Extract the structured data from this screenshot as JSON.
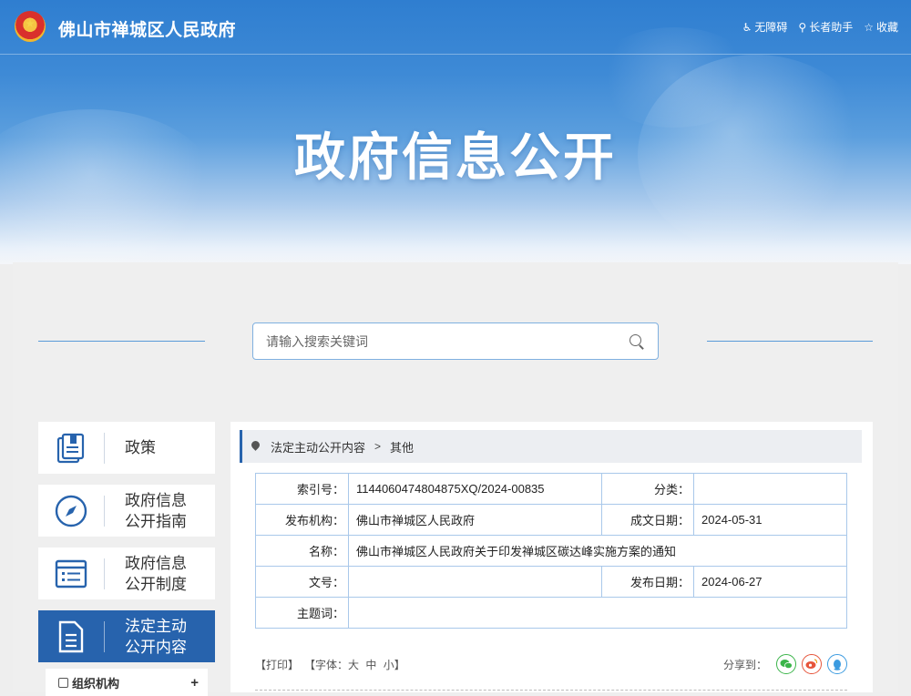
{
  "header": {
    "site_title": "佛山市禅城区人民政府",
    "toolbar": [
      {
        "icon": "accessibility-icon",
        "label": "无障碍"
      },
      {
        "icon": "elder-assistant-icon",
        "label": "长者助手"
      },
      {
        "icon": "star-icon",
        "label": "收藏"
      }
    ],
    "hero_title": "政府信息公开"
  },
  "search": {
    "placeholder": "请输入搜索关键词",
    "value": ""
  },
  "sidebar": {
    "items": [
      {
        "label": "政策",
        "icon": "document-icon",
        "active": false
      },
      {
        "label": "政府信息\n公开指南",
        "icon": "compass-icon",
        "active": false
      },
      {
        "label": "政府信息\n公开制度",
        "icon": "list-icon",
        "active": false
      },
      {
        "label": "法定主动\n公开内容",
        "icon": "file-icon",
        "active": true
      }
    ],
    "sub_item": {
      "label": "组织机构",
      "icon": "folder-icon",
      "expander": "+"
    }
  },
  "breadcrumb": {
    "items": [
      "法定主动公开内容",
      "其他"
    ],
    "separator": ">"
  },
  "meta": {
    "index_label": "索引号：",
    "index_value": "1144060474804875XQ/2024-00835",
    "category_label": "分类：",
    "category_value": "",
    "publisher_label": "发布机构：",
    "publisher_value": "佛山市禅城区人民政府",
    "written_date_label": "成文日期：",
    "written_date_value": "2024-05-31",
    "name_label": "名称：",
    "name_value": "佛山市禅城区人民政府关于印发禅城区碳达峰实施方案的通知",
    "doc_no_label": "文号：",
    "doc_no_value": "",
    "publish_date_label": "发布日期：",
    "publish_date_value": "2024-06-27",
    "subject_label": "主题词：",
    "subject_value": ""
  },
  "tools": {
    "print": "【打印】",
    "font_label": "【字体：",
    "font_large": "大",
    "font_medium": "中",
    "font_small": "小",
    "font_close": "】",
    "share_label": "分享到：",
    "share_icons": [
      "wechat-icon",
      "weibo-icon",
      "qq-icon"
    ]
  },
  "colors": {
    "accent": "#2763ad",
    "border": "#a9c8ea",
    "wechat": "#3bb54a",
    "weibo": "#e6553b",
    "qq": "#3b9be0"
  }
}
